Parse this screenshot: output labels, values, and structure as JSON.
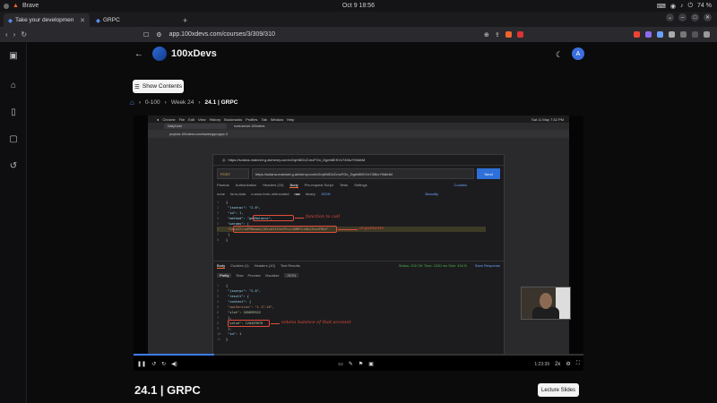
{
  "os": {
    "app_name": "Brave",
    "datetime": "Oct 9  18:56",
    "battery": "74 %"
  },
  "browser": {
    "tabs": [
      {
        "label": "Take your developmen"
      },
      {
        "label": "GRPC"
      }
    ],
    "new_tab": "+",
    "url": "app.100xdevs.com/courses/3/309/310"
  },
  "site": {
    "brand": "100xDevs",
    "user_initial": "A"
  },
  "page": {
    "show_contents": "Show Contents",
    "breadcrumb": [
      "0-100",
      "Week 24",
      "24.1 | GRPC"
    ],
    "lesson_title": "24.1 | GRPC",
    "lecture_slides": "Lecture Slides"
  },
  "video": {
    "mac_menu": [
      "Chrome",
      "File",
      "Edit",
      "View",
      "History",
      "Bookmarks",
      "Profiles",
      "Tab",
      "Window",
      "Help"
    ],
    "mac_clock": "Sat 11 May  7:32 PM",
    "inner_tabs": [
      "DailyCode",
      "sumi-server-100xdevs"
    ],
    "inner_url": "projects.100xdevs.com/tracks/grpc/grpc-3",
    "postman": {
      "title": "https://solana-mainnet.g.alchemy.com/v2/qhNlDUCmzFGn_Dgeh8KKVx745kvY9dkhM",
      "method": "POST",
      "url": "https://solana-mainnet.g.alchemy.com/v2/qhNlDUCmzFGn_Dgeh8KKVx745kvY9dkhM",
      "send": "Send",
      "tabs": [
        "Params",
        "Authorization",
        "Headers (10)",
        "Body",
        "Pre-request Script",
        "Tests",
        "Settings"
      ],
      "cookies": "Cookies",
      "beautify": "Beautify",
      "body_modes": [
        "none",
        "form-data",
        "x-www-form-urlencoded",
        "raw",
        "binary",
        "JSON"
      ],
      "request_lines": [
        "{",
        "  \"jsonrpc\": \"2.0\",",
        "  \"id\": 1,",
        "  \"method\": \"getBalance\",",
        "  \"params\": [",
        "    \"GxcoZ2rnaPPNammAj1Kkcb3Y4YmCPhiJ4DMM7L48bJ2EaxFMk8\"",
        "  ]",
        "}"
      ],
      "response_tabs": [
        "Body",
        "Cookies (1)",
        "Headers (10)",
        "Test Results"
      ],
      "status": "Status: 200 OK   Time: 1330 ms   Size: 434 B",
      "save_response": "Save Response",
      "view_modes": [
        "Pretty",
        "Raw",
        "Preview",
        "Visualize",
        "JSON"
      ],
      "response_lines": [
        "{",
        "  \"jsonrpc\": \"2.0\",",
        "  \"result\": {",
        "    \"context\": {",
        "      \"apiVersion\": \"1.17.28\",",
        "      \"slot\": 265699522",
        "    },",
        "    \"value\": 120459078",
        "  },",
        "  \"id\": 1",
        "}"
      ]
    },
    "annotations": {
      "function": "function to call",
      "arguments": "arguments",
      "balance": "solana balance of that account"
    },
    "time": "1:23:39",
    "speed": "2x",
    "progress": 0.18
  }
}
